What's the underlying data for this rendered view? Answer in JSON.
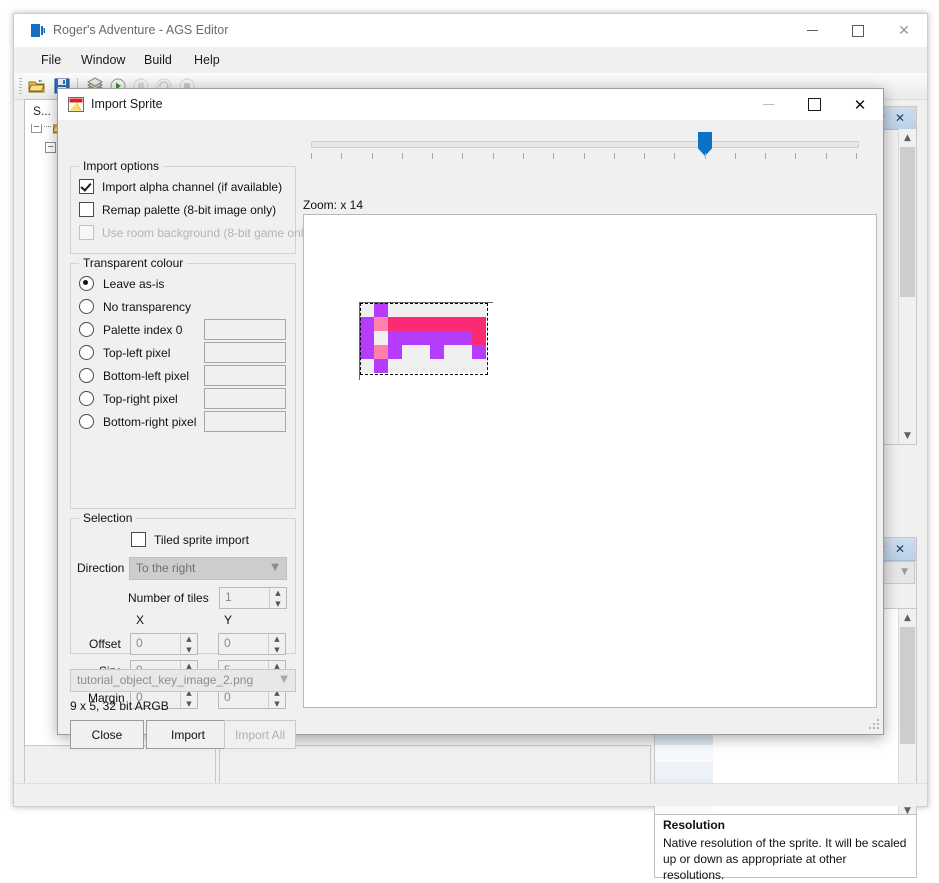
{
  "app": {
    "title": "Roger's Adventure - AGS Editor",
    "title_icon": "ags-logo-icon",
    "window_controls": {
      "minimize": "—",
      "maximize": "□",
      "close": "✕"
    },
    "menu": [
      "File",
      "Window",
      "Build",
      "Help"
    ],
    "toolbar": [
      "open-folder-icon",
      "save-icon",
      "build-icon",
      "run-icon",
      "pause-icon",
      "step-icon",
      "stop-icon"
    ],
    "left_tab_label": "S...",
    "status_text": ""
  },
  "right_dock": {
    "pin_icon": "pin-icon",
    "close_icon": "close-icon",
    "description_title": "Resolution",
    "description_body": "Native resolution of the sprite. It will be scaled up or down as appropriate at other resolutions."
  },
  "dialog": {
    "title": "Import Sprite",
    "icon": "import-sprite-icon",
    "window_controls": {
      "minimize": "—",
      "maximize": "□",
      "close": "✕"
    },
    "import_options": {
      "legend": "Import options",
      "items": [
        {
          "label": "Import alpha channel (if available)",
          "checked": true,
          "enabled": true
        },
        {
          "label": "Remap palette (8-bit image only)",
          "checked": false,
          "enabled": true
        },
        {
          "label": "Use room background (8-bit game only)",
          "checked": false,
          "enabled": false
        }
      ]
    },
    "transparent_colour": {
      "legend": "Transparent colour",
      "options": [
        {
          "label": "Leave as-is",
          "selected": true,
          "has_swatch": false
        },
        {
          "label": "No transparency",
          "selected": false,
          "has_swatch": false
        },
        {
          "label": "Palette index 0",
          "selected": false,
          "has_swatch": true
        },
        {
          "label": "Top-left pixel",
          "selected": false,
          "has_swatch": true
        },
        {
          "label": "Bottom-left pixel",
          "selected": false,
          "has_swatch": true
        },
        {
          "label": "Top-right pixel",
          "selected": false,
          "has_swatch": true
        },
        {
          "label": "Bottom-right pixel",
          "selected": false,
          "has_swatch": true
        }
      ]
    },
    "selection": {
      "legend": "Selection",
      "tiled_sprite_import_label": "Tiled sprite import",
      "tiled_sprite_import_checked": false,
      "direction_label": "Direction",
      "direction_value": "To the right",
      "number_of_tiles_label": "Number of tiles",
      "number_of_tiles_value": "1",
      "col_x_label": "X",
      "col_y_label": "Y",
      "rows": [
        {
          "label": "Offset",
          "x": "0",
          "y": "0"
        },
        {
          "label": "Size",
          "x": "9",
          "y": "5"
        },
        {
          "label": "Margin",
          "x": "0",
          "y": "0"
        }
      ]
    },
    "file_name": "tutorial_object_key_image_2.png",
    "image_info": "9 x 5, 32 bit ARGB",
    "buttons": [
      {
        "label": "Close",
        "enabled": true
      },
      {
        "label": "Import",
        "enabled": true
      },
      {
        "label": "Import All",
        "enabled": false
      }
    ],
    "preview": {
      "zoom_label": "Zoom: x 14",
      "zoom_factor": 14,
      "zoom_tick_count": 19,
      "zoom_thumb_index": 13,
      "sprite_width": 9,
      "sprite_height": 5,
      "palette": {
        "transparent": "#f0f0f0",
        "purple": "#b53cfa",
        "pink": "#ff80ad",
        "magenta": "#fc2a74"
      },
      "pixels": [
        [
          "transparent",
          "purple",
          "transparent",
          "transparent",
          "transparent",
          "transparent",
          "transparent",
          "transparent",
          "transparent"
        ],
        [
          "purple",
          "pink",
          "magenta",
          "magenta",
          "magenta",
          "magenta",
          "magenta",
          "magenta",
          "magenta"
        ],
        [
          "purple",
          "transparent",
          "purple",
          "purple",
          "purple",
          "purple",
          "purple",
          "purple",
          "magenta"
        ],
        [
          "purple",
          "pink",
          "purple",
          "transparent",
          "transparent",
          "purple",
          "transparent",
          "transparent",
          "purple"
        ],
        [
          "transparent",
          "purple",
          "transparent",
          "transparent",
          "transparent",
          "transparent",
          "transparent",
          "transparent",
          "transparent"
        ]
      ]
    }
  }
}
